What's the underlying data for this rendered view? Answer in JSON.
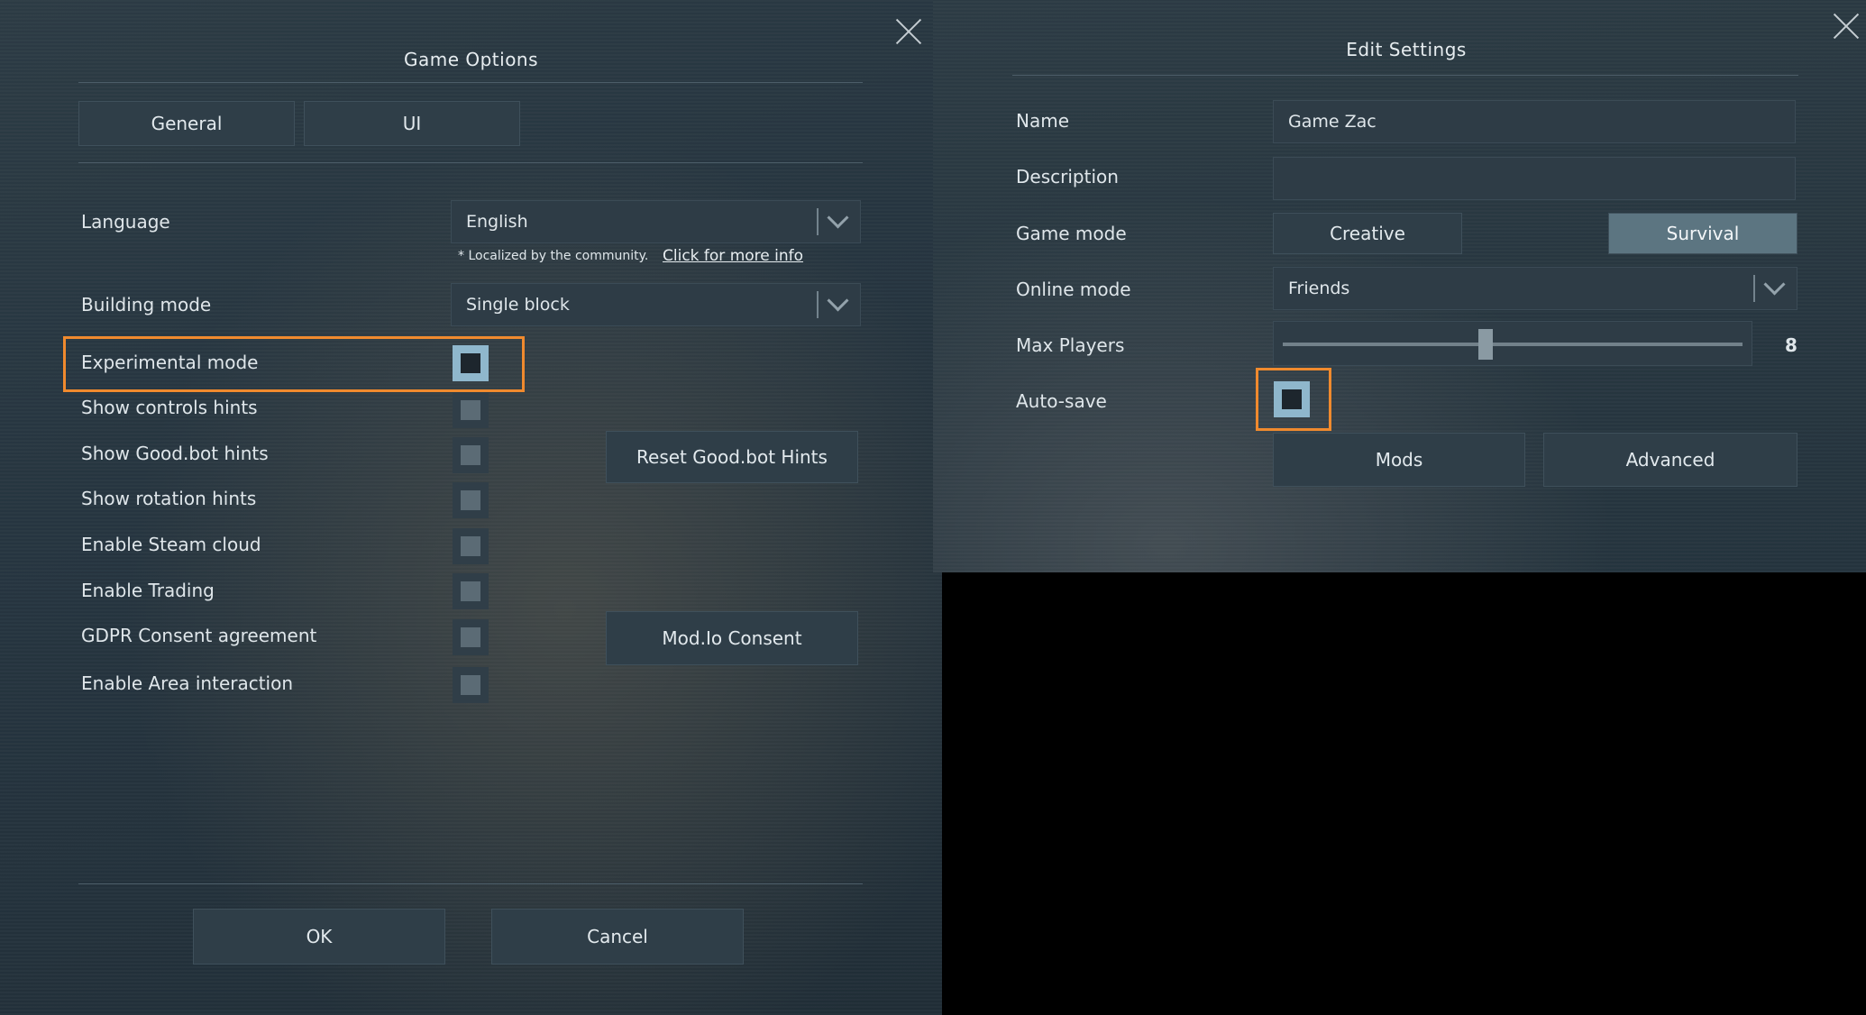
{
  "game_options": {
    "title": "Game Options",
    "tabs": [
      {
        "label": "General"
      },
      {
        "label": "UI"
      }
    ],
    "language": {
      "label": "Language",
      "value": "English"
    },
    "localization_note": "* Localized by the community.",
    "localization_link": "Click for more info",
    "building_mode": {
      "label": "Building mode",
      "value": "Single block"
    },
    "settings": [
      {
        "label": "Experimental mode",
        "checked": false
      },
      {
        "label": "Show controls hints",
        "checked": false
      },
      {
        "label": "Show Good.bot hints",
        "checked": false
      },
      {
        "label": "Show rotation hints",
        "checked": false
      },
      {
        "label": "Enable Steam cloud",
        "checked": false
      },
      {
        "label": "Enable Trading",
        "checked": false
      },
      {
        "label": "GDPR Consent agreement",
        "checked": false
      },
      {
        "label": "Enable Area interaction",
        "checked": false
      }
    ],
    "reset_goodbot_label": "Reset Good.bot Hints",
    "modio_consent_label": "Mod.Io Consent",
    "ok_label": "OK",
    "cancel_label": "Cancel"
  },
  "edit_settings": {
    "title": "Edit Settings",
    "name": {
      "label": "Name",
      "value": "Game Zac"
    },
    "description": {
      "label": "Description",
      "value": ""
    },
    "game_mode": {
      "label": "Game mode",
      "options": [
        "Creative",
        "Survival"
      ],
      "selected": "Survival"
    },
    "online_mode": {
      "label": "Online mode",
      "value": "Friends"
    },
    "max_players": {
      "label": "Max Players",
      "value": "8",
      "slider_fraction": 0.49
    },
    "auto_save": {
      "label": "Auto-save",
      "checked": false
    },
    "mods_label": "Mods",
    "advanced_label": "Advanced"
  },
  "colors": {
    "highlight": "#f08a2e",
    "selected_button": "#5c7581",
    "panel_background": "#263540"
  }
}
